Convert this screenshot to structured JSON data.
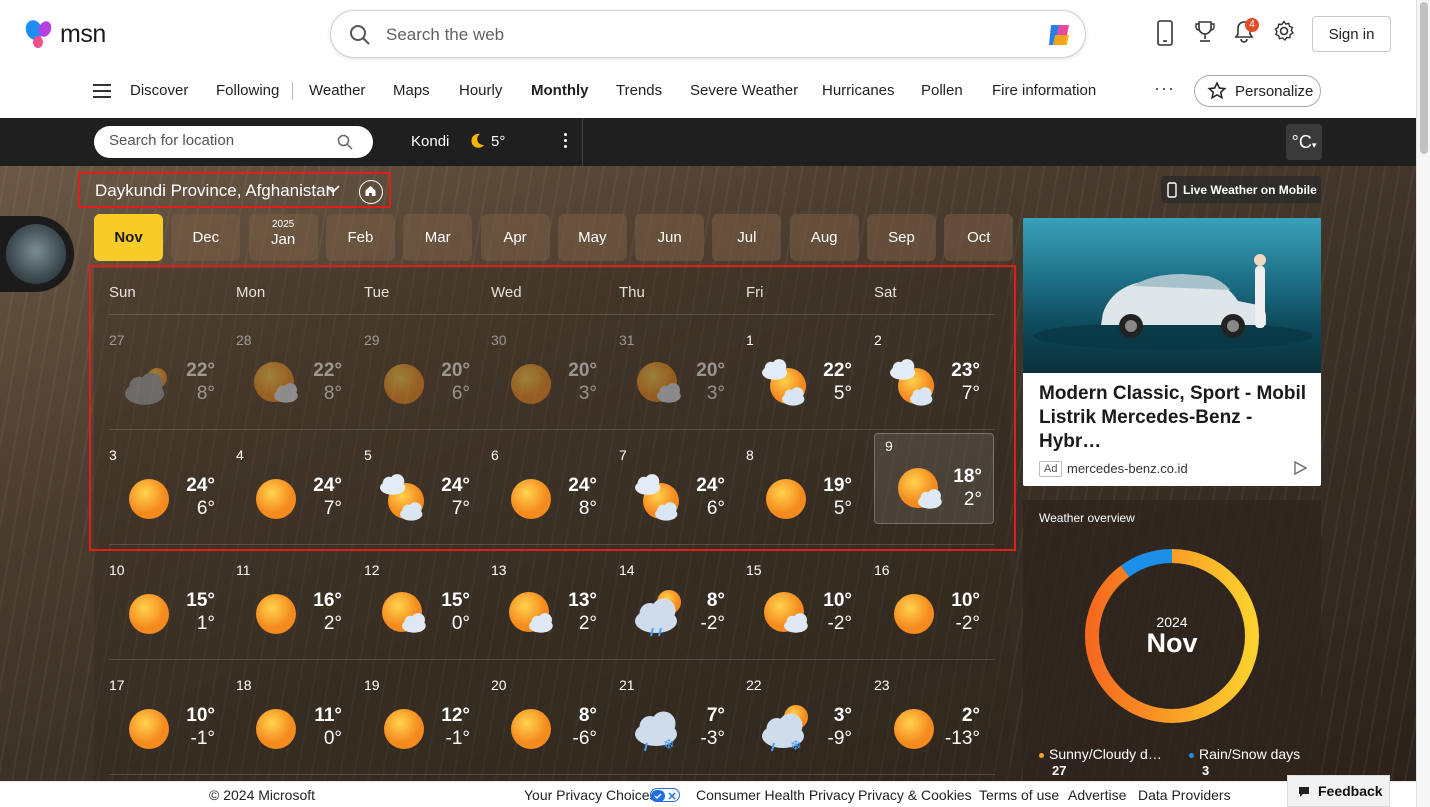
{
  "header": {
    "brand": "msn",
    "search_placeholder": "Search the web",
    "notification_count": "4",
    "signin_label": "Sign in"
  },
  "nav": {
    "items": [
      {
        "label": "Discover",
        "active": false
      },
      {
        "label": "Following",
        "active": false
      },
      {
        "label": "Weather",
        "active": false
      },
      {
        "label": "Maps",
        "active": false
      },
      {
        "label": "Hourly",
        "active": false
      },
      {
        "label": "Monthly",
        "active": true
      },
      {
        "label": "Trends",
        "active": false
      },
      {
        "label": "Severe Weather",
        "active": false
      },
      {
        "label": "Hurricanes",
        "active": false
      },
      {
        "label": "Pollen",
        "active": false
      },
      {
        "label": "Fire information",
        "active": false
      }
    ],
    "more": "···",
    "personalize_label": "Personalize"
  },
  "weather": {
    "location_search_placeholder": "Search for location",
    "current_city": "Kondi",
    "current_temp": "5°",
    "unit": "°C",
    "region": "Daykundi Province, Afghanistan",
    "live_mobile_label": "Live Weather on Mobile",
    "months": [
      {
        "label": "Nov",
        "year": "",
        "active": true
      },
      {
        "label": "Dec",
        "year": "",
        "active": false
      },
      {
        "label": "Jan",
        "year": "2025",
        "active": false
      },
      {
        "label": "Feb",
        "year": "",
        "active": false
      },
      {
        "label": "Mar",
        "year": "",
        "active": false
      },
      {
        "label": "Apr",
        "year": "",
        "active": false
      },
      {
        "label": "May",
        "year": "",
        "active": false
      },
      {
        "label": "Jun",
        "year": "",
        "active": false
      },
      {
        "label": "Jul",
        "year": "",
        "active": false
      },
      {
        "label": "Aug",
        "year": "",
        "active": false
      },
      {
        "label": "Sep",
        "year": "",
        "active": false
      },
      {
        "label": "Oct",
        "year": "",
        "active": false
      }
    ],
    "weekdays": [
      "Sun",
      "Mon",
      "Tue",
      "Wed",
      "Thu",
      "Fri",
      "Sat"
    ],
    "weeks": [
      [
        {
          "day": "27",
          "hi": "22°",
          "lo": "8°",
          "icon": "cloudy-icon",
          "past": true
        },
        {
          "day": "28",
          "hi": "22°",
          "lo": "8°",
          "icon": "partly-sunny-icon",
          "past": true
        },
        {
          "day": "29",
          "hi": "20°",
          "lo": "6°",
          "icon": "sunny-icon",
          "past": true
        },
        {
          "day": "30",
          "hi": "20°",
          "lo": "3°",
          "icon": "sunny-icon",
          "past": true
        },
        {
          "day": "31",
          "hi": "20°",
          "lo": "3°",
          "icon": "partly-sunny-icon",
          "past": true
        },
        {
          "day": "1",
          "hi": "22°",
          "lo": "5°",
          "icon": "mostly-cloudy-icon",
          "past": false
        },
        {
          "day": "2",
          "hi": "23°",
          "lo": "7°",
          "icon": "mostly-cloudy-icon",
          "past": false
        }
      ],
      [
        {
          "day": "3",
          "hi": "24°",
          "lo": "6°",
          "icon": "sunny-icon",
          "past": false
        },
        {
          "day": "4",
          "hi": "24°",
          "lo": "7°",
          "icon": "sunny-icon",
          "past": false
        },
        {
          "day": "5",
          "hi": "24°",
          "lo": "7°",
          "icon": "mostly-cloudy-icon",
          "past": false
        },
        {
          "day": "6",
          "hi": "24°",
          "lo": "8°",
          "icon": "sunny-icon",
          "past": false
        },
        {
          "day": "7",
          "hi": "24°",
          "lo": "6°",
          "icon": "mostly-cloudy-icon",
          "past": false
        },
        {
          "day": "8",
          "hi": "19°",
          "lo": "5°",
          "icon": "sunny-icon",
          "past": false
        },
        {
          "day": "9",
          "hi": "18°",
          "lo": "2°",
          "icon": "partly-sunny-icon",
          "past": false,
          "today": true
        }
      ],
      [
        {
          "day": "10",
          "hi": "15°",
          "lo": "1°",
          "icon": "sunny-icon",
          "past": false
        },
        {
          "day": "11",
          "hi": "16°",
          "lo": "2°",
          "icon": "sunny-icon",
          "past": false
        },
        {
          "day": "12",
          "hi": "15°",
          "lo": "0°",
          "icon": "partly-sunny-icon",
          "past": false
        },
        {
          "day": "13",
          "hi": "13°",
          "lo": "2°",
          "icon": "partly-sunny-icon",
          "past": false
        },
        {
          "day": "14",
          "hi": "8°",
          "lo": "-2°",
          "icon": "rain-sun-icon",
          "past": false
        },
        {
          "day": "15",
          "hi": "10°",
          "lo": "-2°",
          "icon": "partly-sunny-icon",
          "past": false
        },
        {
          "day": "16",
          "hi": "10°",
          "lo": "-2°",
          "icon": "sunny-icon",
          "past": false
        }
      ],
      [
        {
          "day": "17",
          "hi": "10°",
          "lo": "-1°",
          "icon": "sunny-icon",
          "past": false
        },
        {
          "day": "18",
          "hi": "11°",
          "lo": "0°",
          "icon": "sunny-icon",
          "past": false
        },
        {
          "day": "19",
          "hi": "12°",
          "lo": "-1°",
          "icon": "sunny-icon",
          "past": false
        },
        {
          "day": "20",
          "hi": "8°",
          "lo": "-6°",
          "icon": "sunny-icon",
          "past": false
        },
        {
          "day": "21",
          "hi": "7°",
          "lo": "-3°",
          "icon": "snow-icon",
          "past": false
        },
        {
          "day": "22",
          "hi": "3°",
          "lo": "-9°",
          "icon": "snow-sun-icon",
          "past": false
        },
        {
          "day": "23",
          "hi": "2°",
          "lo": "-13°",
          "icon": "sunny-icon",
          "past": false
        }
      ]
    ]
  },
  "ad": {
    "title": "Modern Classic, Sport - Mobil Listrik Mercedes-Benz - Hybr…",
    "tag": "Ad",
    "domain": "mercedes-benz.co.id"
  },
  "overview": {
    "title": "Weather overview",
    "year": "2024",
    "month": "Nov",
    "legend": [
      {
        "label": "Sunny/Cloudy d…",
        "value": "27",
        "color": "#f5a623"
      },
      {
        "label": "Rain/Snow days",
        "value": "3",
        "color": "#1e8fe8"
      }
    ],
    "ring_fraction_sunny": 0.9
  },
  "footer": {
    "copyright": "© 2024 Microsoft",
    "links": [
      "Your Privacy Choices",
      "Consumer Health Privacy",
      "Privacy & Cookies",
      "Terms of use",
      "Advertise",
      "Data Providers"
    ],
    "feedback_label": "Feedback"
  },
  "colors": {
    "accent_month": "#f8cc28",
    "highlight": "#e01e1e",
    "sun": "#f5a623"
  }
}
